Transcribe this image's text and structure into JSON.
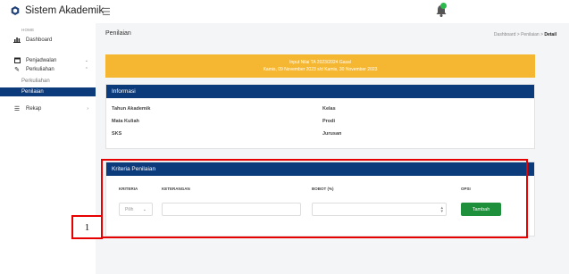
{
  "app": {
    "title": "Sistem Akademik"
  },
  "sidebar": {
    "home_label": "HOME",
    "items": [
      {
        "label": "Dashboard",
        "icon": "bar-chart-icon"
      },
      {
        "label": "Penjadwalan",
        "icon": "calendar-icon"
      },
      {
        "label": "Perkuliahan",
        "icon": "pencil-icon"
      },
      {
        "label": "Rekap",
        "icon": "list-icon"
      }
    ],
    "sub_items": [
      {
        "label": "Perkuliahan",
        "active": false
      },
      {
        "label": "Penilaian",
        "active": true
      }
    ]
  },
  "page": {
    "title": "Penilaian",
    "breadcrumb": [
      "Dashboard",
      "Penilaian",
      "Detail"
    ]
  },
  "alert": {
    "line1": "Input Nilai TA 2023/2024 Gasal",
    "line2": "Kamis, 09 November 2023 s/d Kamis, 30 November 2023",
    "color": "#f5b731"
  },
  "info": {
    "header": "Informasi",
    "labels": [
      "Tahun Akademik",
      "Mata Kuliah",
      "SKS",
      "Kelas",
      "Prodi",
      "Jurusan"
    ]
  },
  "kriteria": {
    "header": "Kriteria Penilaian",
    "columns": [
      "KRITERIA",
      "KETERANGAN",
      "BOBOT (%)",
      "OPSI"
    ],
    "select_placeholder": "Pilih",
    "add_button": "Tambah"
  },
  "annotation": {
    "label": "1"
  },
  "colors": {
    "primary": "#0c3b7c",
    "warning": "#f5b731",
    "success": "#1e8f3a",
    "annotation": "#e60000"
  }
}
